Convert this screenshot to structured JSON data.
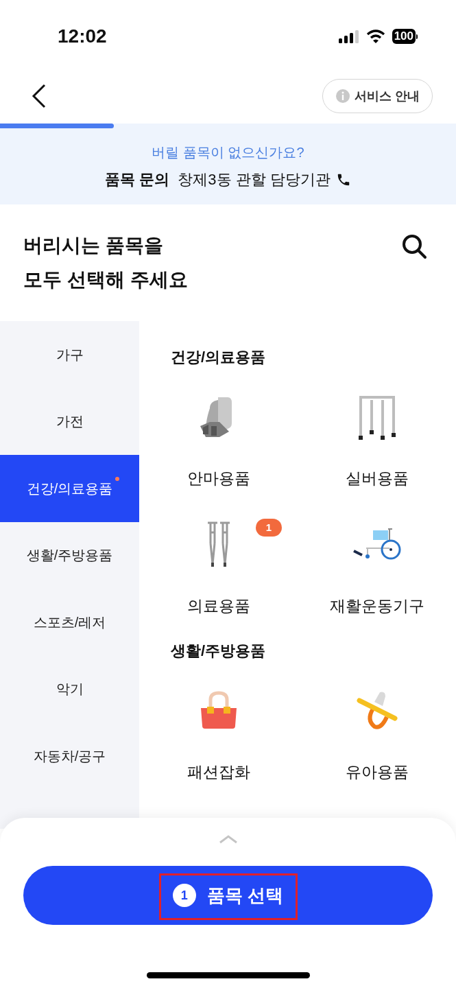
{
  "status_bar": {
    "time": "12:02",
    "battery": "100"
  },
  "header": {
    "service_button": "서비스 안내"
  },
  "progress": {
    "level": 0.25
  },
  "banner": {
    "question": "버릴 품목이 없으신가요?",
    "label": "품목 문의",
    "agency": "창제3동 관할 담당기관"
  },
  "title": {
    "lines": [
      "버리시는 품목을",
      "모두 선택해 주세요"
    ]
  },
  "sidebar": {
    "items": [
      {
        "label": "가구",
        "selected": false,
        "has_items": false
      },
      {
        "label": "가전",
        "selected": false,
        "has_items": false
      },
      {
        "label": "건강/의료용품",
        "selected": true,
        "has_items": true
      },
      {
        "label": "생활/주방용품",
        "selected": false,
        "has_items": false
      },
      {
        "label": "스포츠/레저",
        "selected": false,
        "has_items": false
      },
      {
        "label": "악기",
        "selected": false,
        "has_items": false
      },
      {
        "label": "자동차/공구",
        "selected": false,
        "has_items": false
      }
    ]
  },
  "sections": [
    {
      "title": "건강/의료용품",
      "items": [
        {
          "label": "안마용품",
          "kind": "massage-chair"
        },
        {
          "label": "실버용품",
          "kind": "walker"
        },
        {
          "label": "의료용품",
          "kind": "crutches",
          "count": "1"
        },
        {
          "label": "재활운동기구",
          "kind": "wheelchair"
        }
      ]
    },
    {
      "title": "생활/주방용품",
      "items": [
        {
          "label": "패션잡화",
          "kind": "handbag"
        },
        {
          "label": "유아용품",
          "kind": "pacifier"
        }
      ]
    }
  ],
  "bottom": {
    "count": "1",
    "button": "품목 선택"
  }
}
